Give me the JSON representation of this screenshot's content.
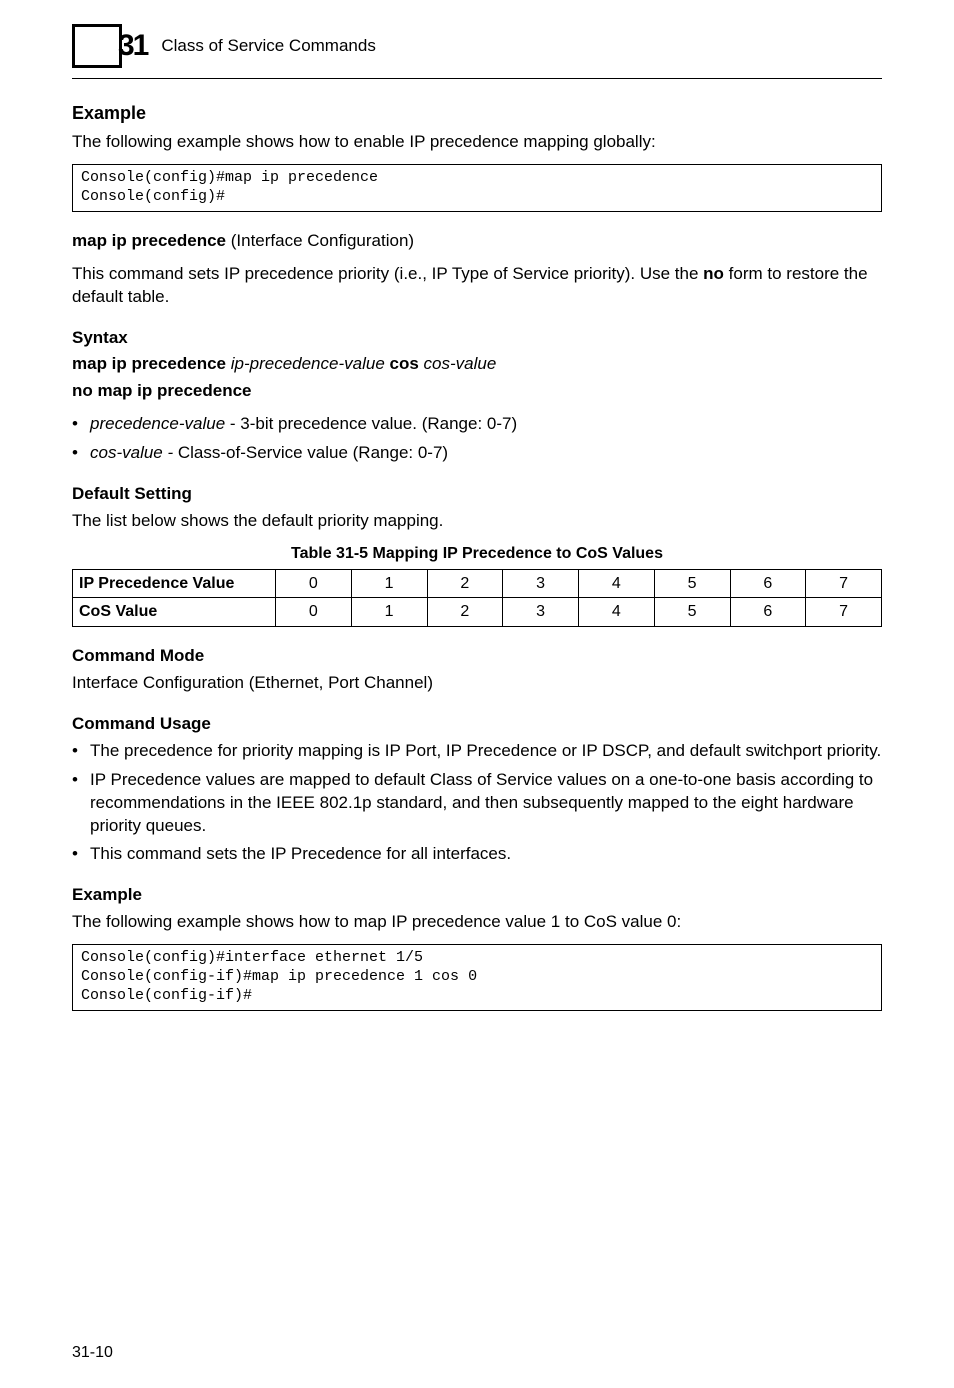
{
  "header": {
    "chapter_number": "31",
    "chapter_label": "Class of Service Commands"
  },
  "s_example1": {
    "heading": "Example",
    "intro": "The following example shows how to enable IP precedence mapping globally:",
    "code": "Console(config)#map ip precedence\nConsole(config)#"
  },
  "s_cmd": {
    "heading_cmd": "map ip precedence",
    "heading_suffix": " (Interface Configuration)",
    "desc_pre": "This command sets IP precedence priority (i.e., IP Type of Service priority). Use the ",
    "desc_bold": "no",
    "desc_post": " form to restore the default table."
  },
  "s_syntax": {
    "heading": "Syntax",
    "line1_b1": "map ip precedence ",
    "line1_i1": "ip-precedence-value",
    "line1_b2": " cos ",
    "line1_i2": "cos-value",
    "line2_b": "no map ip precedence",
    "param1_name": "precedence-value",
    "param1_desc": " - 3-bit precedence value. (Range: 0-7)",
    "param2_name": "cos-value -",
    "param2_desc": " Class-of-Service value (Range: 0-7)"
  },
  "s_default": {
    "heading": "Default Setting",
    "text": "The list below shows the default priority mapping."
  },
  "table": {
    "caption": "Table 31-5   Mapping IP Precedence to CoS Values",
    "row1_label": "IP Precedence Value",
    "row2_label": "CoS Value",
    "row1_values": [
      "0",
      "1",
      "2",
      "3",
      "4",
      "5",
      "6",
      "7"
    ],
    "row2_values": [
      "0",
      "1",
      "2",
      "3",
      "4",
      "5",
      "6",
      "7"
    ]
  },
  "s_mode": {
    "heading": "Command Mode",
    "text": "Interface Configuration (Ethernet, Port Channel)"
  },
  "s_usage": {
    "heading": "Command Usage",
    "bullets": [
      "The precedence for priority mapping is IP Port, IP Precedence or IP DSCP, and default switchport priority.",
      "IP Precedence values are mapped to default Class of Service values on a one-to-one basis according to recommendations in the IEEE 802.1p standard, and then subsequently mapped to the eight hardware priority queues.",
      "This command sets the IP Precedence for all interfaces."
    ]
  },
  "s_example2": {
    "heading": "Example",
    "intro": "The following example shows how to map IP precedence value 1 to CoS value 0:",
    "code": "Console(config)#interface ethernet 1/5\nConsole(config-if)#map ip precedence 1 cos 0\nConsole(config-if)#"
  },
  "footer": {
    "page_number": "31-10"
  },
  "chart_data": {
    "type": "table",
    "title": "Table 31-5   Mapping IP Precedence to CoS Values",
    "columns": [
      "0",
      "1",
      "2",
      "3",
      "4",
      "5",
      "6",
      "7"
    ],
    "rows": [
      {
        "label": "IP Precedence Value",
        "values": [
          0,
          1,
          2,
          3,
          4,
          5,
          6,
          7
        ]
      },
      {
        "label": "CoS Value",
        "values": [
          0,
          1,
          2,
          3,
          4,
          5,
          6,
          7
        ]
      }
    ]
  }
}
